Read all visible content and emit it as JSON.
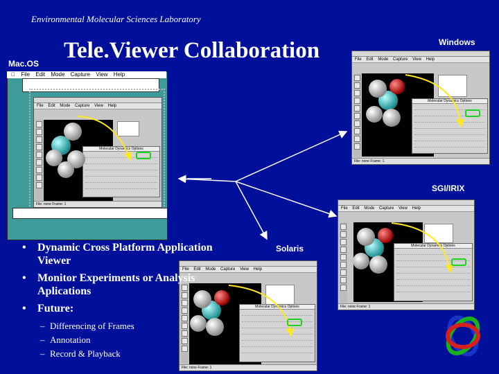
{
  "header": {
    "lab": "Environmental Molecular Sciences Laboratory",
    "title": "Tele.Viewer Collaboration"
  },
  "platforms": {
    "mac": "Mac.OS",
    "windows": "Windows",
    "sgi": "SGI/IRIX",
    "solaris": "Solaris"
  },
  "bullets": [
    "Dynamic Cross Platform Application Viewer",
    "Monitor Experiments or Analysis Aplications",
    "Future:"
  ],
  "sub_bullets": [
    "Differencing of Frames",
    "Annotation",
    "Record & Playback"
  ],
  "app": {
    "menu": [
      "File",
      "Edit",
      "Mode",
      "Capture",
      "View",
      "Help"
    ],
    "mac_menu": [
      "File",
      "Edit",
      "Mode",
      "Capture",
      "View",
      "Help"
    ],
    "dialog_title": "Molecular Dynamics Options",
    "status": "File: none   Frame: 1"
  },
  "colors": {
    "background": "#00109a",
    "highlight": "#1fd21f",
    "mac_desktop": "#3f9a9a"
  }
}
